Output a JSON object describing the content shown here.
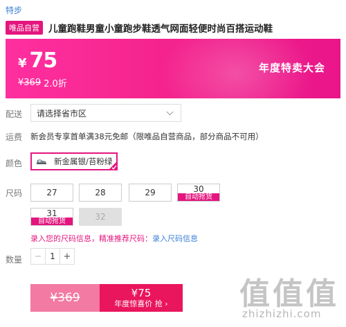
{
  "breadcrumb": "特步",
  "product": {
    "badge": "唯品自营",
    "title": "儿童跑鞋男童小童跑步鞋透气网面轻便时尚百搭运动鞋"
  },
  "banner": {
    "currency": "¥",
    "price": "75",
    "original_price": "¥369",
    "discount": "2.0折",
    "promo": "年度特卖大会",
    "colors": {
      "from": "#ff2fa0",
      "to": "#e9158a"
    }
  },
  "delivery": {
    "label": "配送",
    "placeholder": "请选择省市区"
  },
  "shipping": {
    "label": "运费",
    "text": "新会员专享首单满38元免邮（限唯品自营商品，部分商品不可用）"
  },
  "color": {
    "label": "颜色",
    "selected": "新金属银/苔粉绿"
  },
  "size": {
    "label": "尺码",
    "options": [
      {
        "value": "27",
        "state": "available"
      },
      {
        "value": "28",
        "state": "available"
      },
      {
        "value": "29",
        "state": "available"
      },
      {
        "value": "30",
        "state": "auto",
        "tag": "自动抢货"
      },
      {
        "value": "31",
        "state": "auto",
        "tag": "自动抢货"
      },
      {
        "value": "32",
        "state": "disabled"
      }
    ],
    "note": "录入您的尺码信息，精准推荐尺码：",
    "note_link": "录入尺码信息"
  },
  "quantity": {
    "label": "数量",
    "minus": "−",
    "value": "1",
    "plus": "+"
  },
  "buy": {
    "old_price": "¥369",
    "price": "¥75",
    "caption": "年度惊喜价 抢 ›"
  },
  "watermark": {
    "mark": "值",
    "domain": "zhizhizhi.com"
  },
  "accent": "#e4157e"
}
